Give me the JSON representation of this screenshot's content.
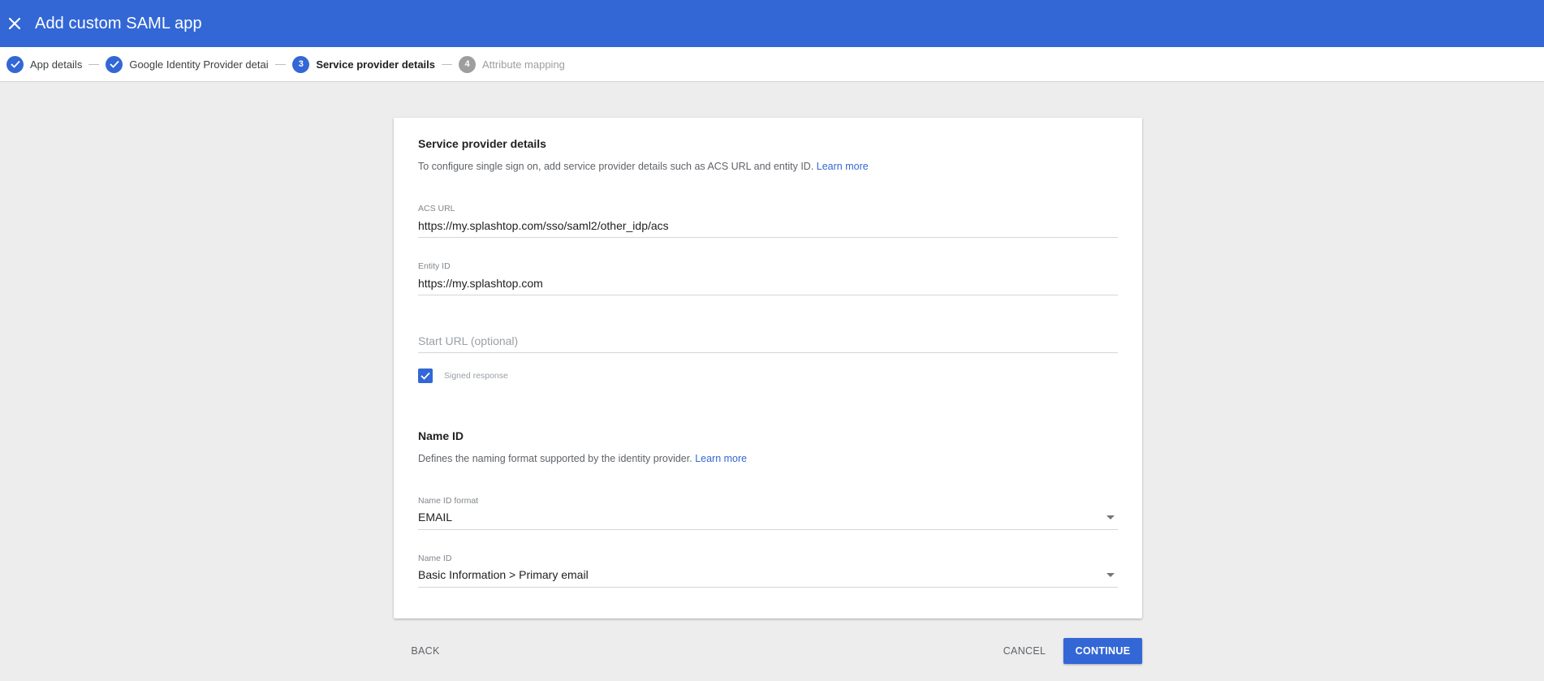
{
  "header": {
    "title": "Add custom SAML app",
    "close_icon": "close-icon",
    "color": "#3367d6"
  },
  "stepper": {
    "steps": [
      {
        "number": "1",
        "label": "App details",
        "state": "done"
      },
      {
        "number": "2",
        "label": "Google Identity Provider details",
        "state": "done"
      },
      {
        "number": "3",
        "label": "Service provider details",
        "state": "active"
      },
      {
        "number": "4",
        "label": "Attribute mapping",
        "state": "pending"
      }
    ]
  },
  "service_provider": {
    "title": "Service provider details",
    "description": "To configure single sign on, add service provider details such as ACS URL and entity ID.",
    "learn_more": "Learn more",
    "acs_url": {
      "label": "ACS URL",
      "value": "https://my.splashtop.com/sso/saml2/other_idp/acs"
    },
    "entity_id": {
      "label": "Entity ID",
      "value": "https://my.splashtop.com"
    },
    "start_url": {
      "placeholder": "Start URL (optional)",
      "value": ""
    },
    "signed_response": {
      "label": "Signed response",
      "checked": true
    }
  },
  "name_id": {
    "title": "Name ID",
    "description": "Defines the naming format supported by the identity provider.",
    "learn_more": "Learn more",
    "format": {
      "label": "Name ID format",
      "value": "EMAIL"
    },
    "name_id": {
      "label": "Name ID",
      "value": "Basic Information > Primary email"
    }
  },
  "footer": {
    "back_label": "BACK",
    "cancel_label": "CANCEL",
    "continue_label": "CONTINUE"
  }
}
